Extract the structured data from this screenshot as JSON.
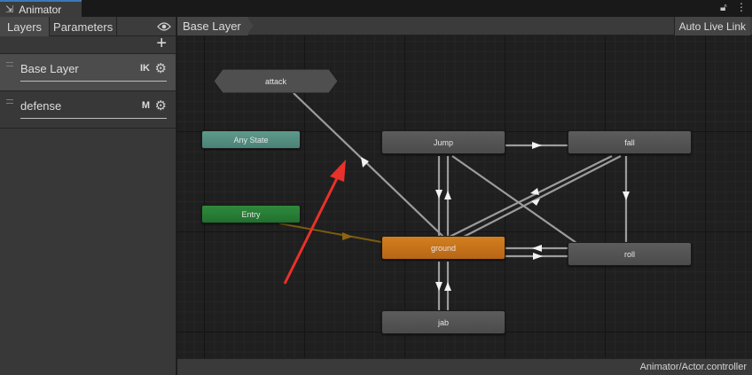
{
  "window": {
    "tab_title": "Animator",
    "tab_icon": "animator-icon",
    "lock_icon": "lock-icon",
    "menu_icon": "kebab-menu-icon"
  },
  "left_panel": {
    "tabs": [
      {
        "label": "Layers",
        "active": true
      },
      {
        "label": "Parameters",
        "active": false
      }
    ],
    "eye_icon": "eye-icon",
    "add_label": "+",
    "layers": [
      {
        "name": "Base Layer",
        "badge": "IK",
        "selected": true
      },
      {
        "name": "defense",
        "badge": "M",
        "selected": false
      }
    ]
  },
  "graph": {
    "breadcrumb": "Base Layer",
    "auto_live_link": "Auto Live Link",
    "nodes": {
      "attack": "attack",
      "any_state": "Any State",
      "entry": "Entry",
      "jump": "Jump",
      "fall": "fall",
      "ground": "ground",
      "roll": "roll",
      "jab": "jab"
    },
    "colors": {
      "default_state": "#505050",
      "any_state": "#56907f",
      "entry": "#27823a",
      "default_layer_state": "#c6701a",
      "annotation_arrow": "#e8312a"
    }
  },
  "status": {
    "controller_path": "Animator/Actor.controller"
  }
}
